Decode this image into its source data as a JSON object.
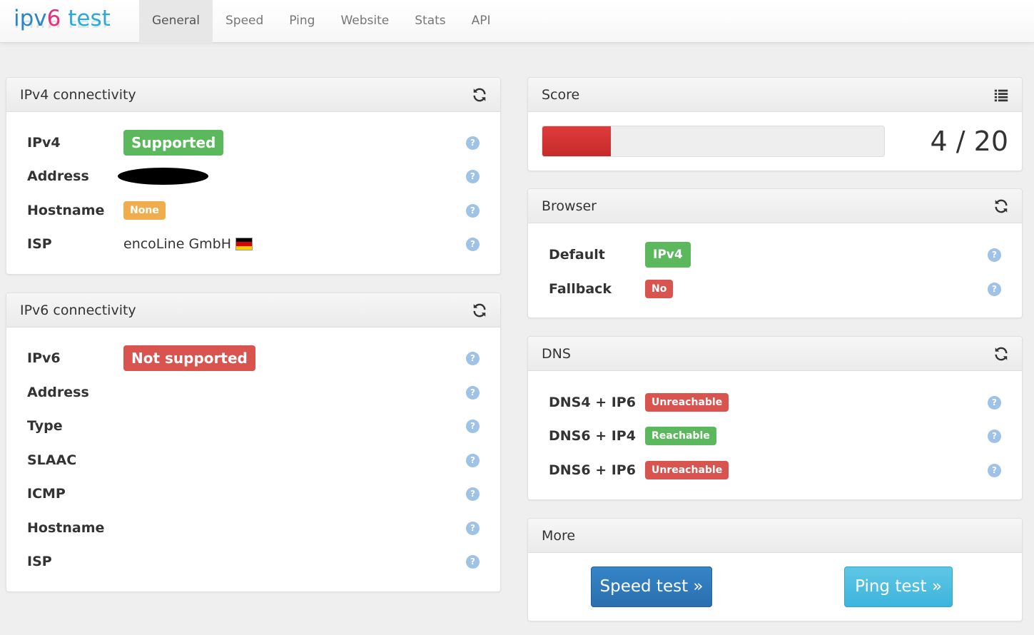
{
  "brand": {
    "part1": "ipv",
    "part2": "6",
    "part3": " test"
  },
  "nav": {
    "items": [
      {
        "label": "General"
      },
      {
        "label": "Speed"
      },
      {
        "label": "Ping"
      },
      {
        "label": "Website"
      },
      {
        "label": "Stats"
      },
      {
        "label": "API"
      }
    ],
    "active": "General"
  },
  "ipv4": {
    "title": "IPv4 connectivity",
    "icon": "refresh-icon",
    "rows": [
      {
        "label": "IPv4",
        "value": "Supported",
        "status": "success"
      },
      {
        "label": "Address",
        "value": "",
        "redacted": true
      },
      {
        "label": "Hostname",
        "value": "None",
        "status": "warning"
      },
      {
        "label": "ISP",
        "value": "encoLine GmbH",
        "flag": "de-flag-icon"
      }
    ]
  },
  "ipv6": {
    "title": "IPv6 connectivity",
    "icon": "refresh-icon",
    "rows": [
      {
        "label": "IPv6",
        "value": "Not supported",
        "status": "danger"
      },
      {
        "label": "Address",
        "value": ""
      },
      {
        "label": "Type",
        "value": ""
      },
      {
        "label": "SLAAC",
        "value": ""
      },
      {
        "label": "ICMP",
        "value": ""
      },
      {
        "label": "Hostname",
        "value": ""
      },
      {
        "label": "ISP",
        "value": ""
      }
    ]
  },
  "score": {
    "title": "Score",
    "icon": "list-icon",
    "text": "4 / 20",
    "value": 4,
    "max": 20,
    "bar_color": "#d9534f"
  },
  "browser": {
    "title": "Browser",
    "icon": "refresh-icon",
    "rows": [
      {
        "label": "Default",
        "value": "IPv4",
        "status": "success"
      },
      {
        "label": "Fallback",
        "value": "No",
        "status": "danger"
      }
    ]
  },
  "dns": {
    "title": "DNS",
    "icon": "refresh-icon",
    "rows": [
      {
        "label": "DNS4 + IP6",
        "value": "Unreachable",
        "status": "danger"
      },
      {
        "label": "DNS6 + IP4",
        "value": "Reachable",
        "status": "success"
      },
      {
        "label": "DNS6 + IP6",
        "value": "Unreachable",
        "status": "danger"
      }
    ]
  },
  "more": {
    "title": "More",
    "speed_button": "Speed test »",
    "ping_button": "Ping test »"
  },
  "help_glyph": "?",
  "colors": {
    "success": "#5cb85c",
    "danger": "#d9534f",
    "warning": "#f0ad4e",
    "primary": "#337ab7",
    "info": "#5bc0de",
    "help": "#9ec3e6"
  }
}
